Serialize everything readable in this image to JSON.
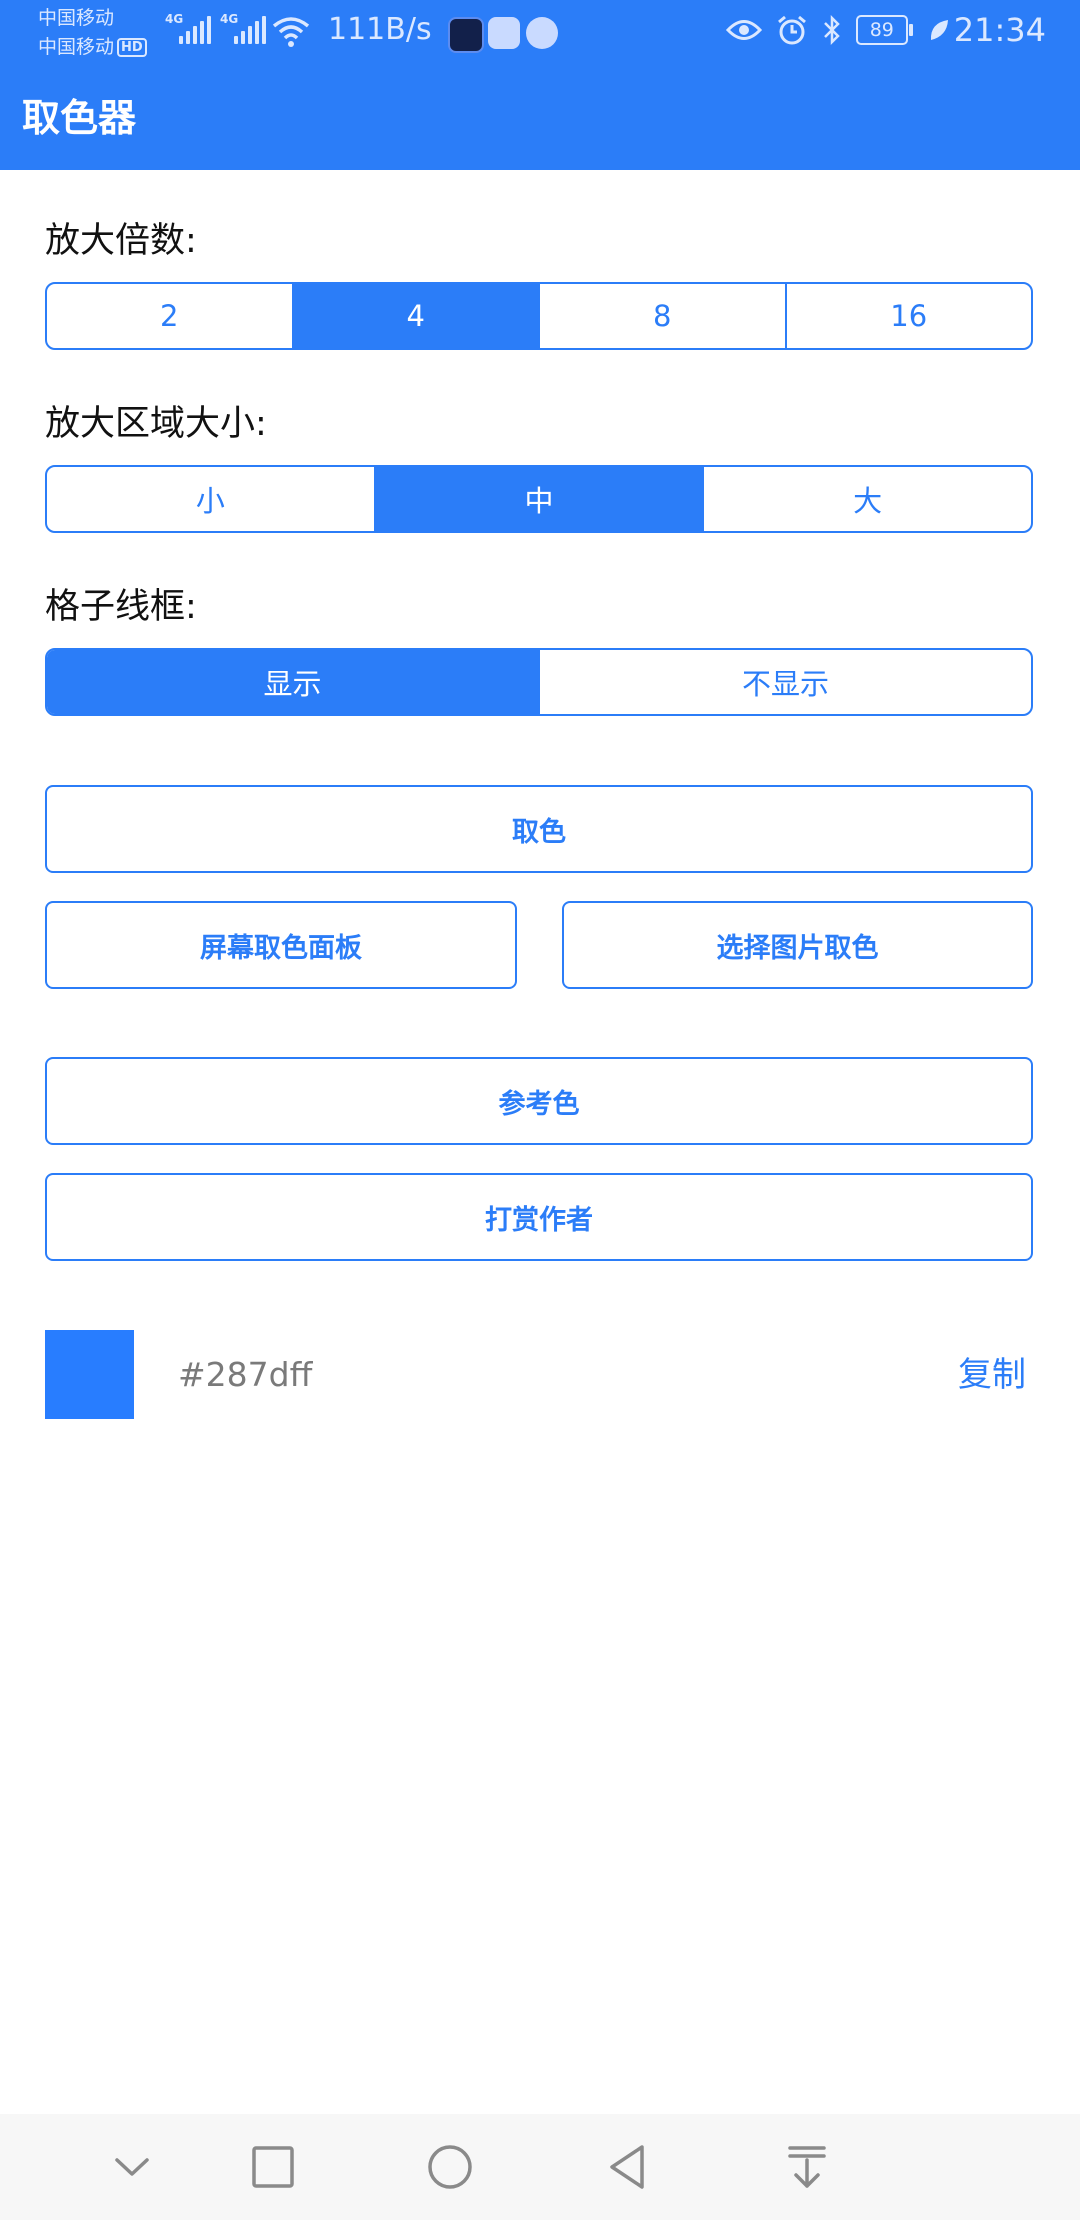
{
  "status_bar": {
    "carrier_1": "中国移动",
    "carrier_2": "中国移动",
    "hd_badge": "HD",
    "network_type_1": "4G",
    "network_type_2": "4G",
    "net_speed": "111B/s",
    "battery_level": "89",
    "time": "21:34"
  },
  "app_bar": {
    "title": "取色器",
    "color": "#2b7df8"
  },
  "zoom": {
    "label": "放大倍数:",
    "options": [
      "2",
      "4",
      "8",
      "16"
    ],
    "selected": "4"
  },
  "zoom_area": {
    "label": "放大区域大小:",
    "options": [
      "小",
      "中",
      "大"
    ],
    "selected": "中"
  },
  "grid": {
    "label": "格子线框:",
    "options": [
      "显示",
      "不显示"
    ],
    "selected": "显示"
  },
  "buttons": {
    "pick_color": "取色",
    "screen_panel": "屏幕取色面板",
    "pick_from_image": "选择图片取色",
    "reference_color": "参考色",
    "tip_author": "打赏作者"
  },
  "result": {
    "color_hex": "#287dff",
    "copy_label": "复制"
  },
  "nav_bar": {
    "icons": [
      "chevron-down-icon",
      "square-recent-icon",
      "circle-home-icon",
      "triangle-back-icon",
      "download-icon"
    ]
  }
}
